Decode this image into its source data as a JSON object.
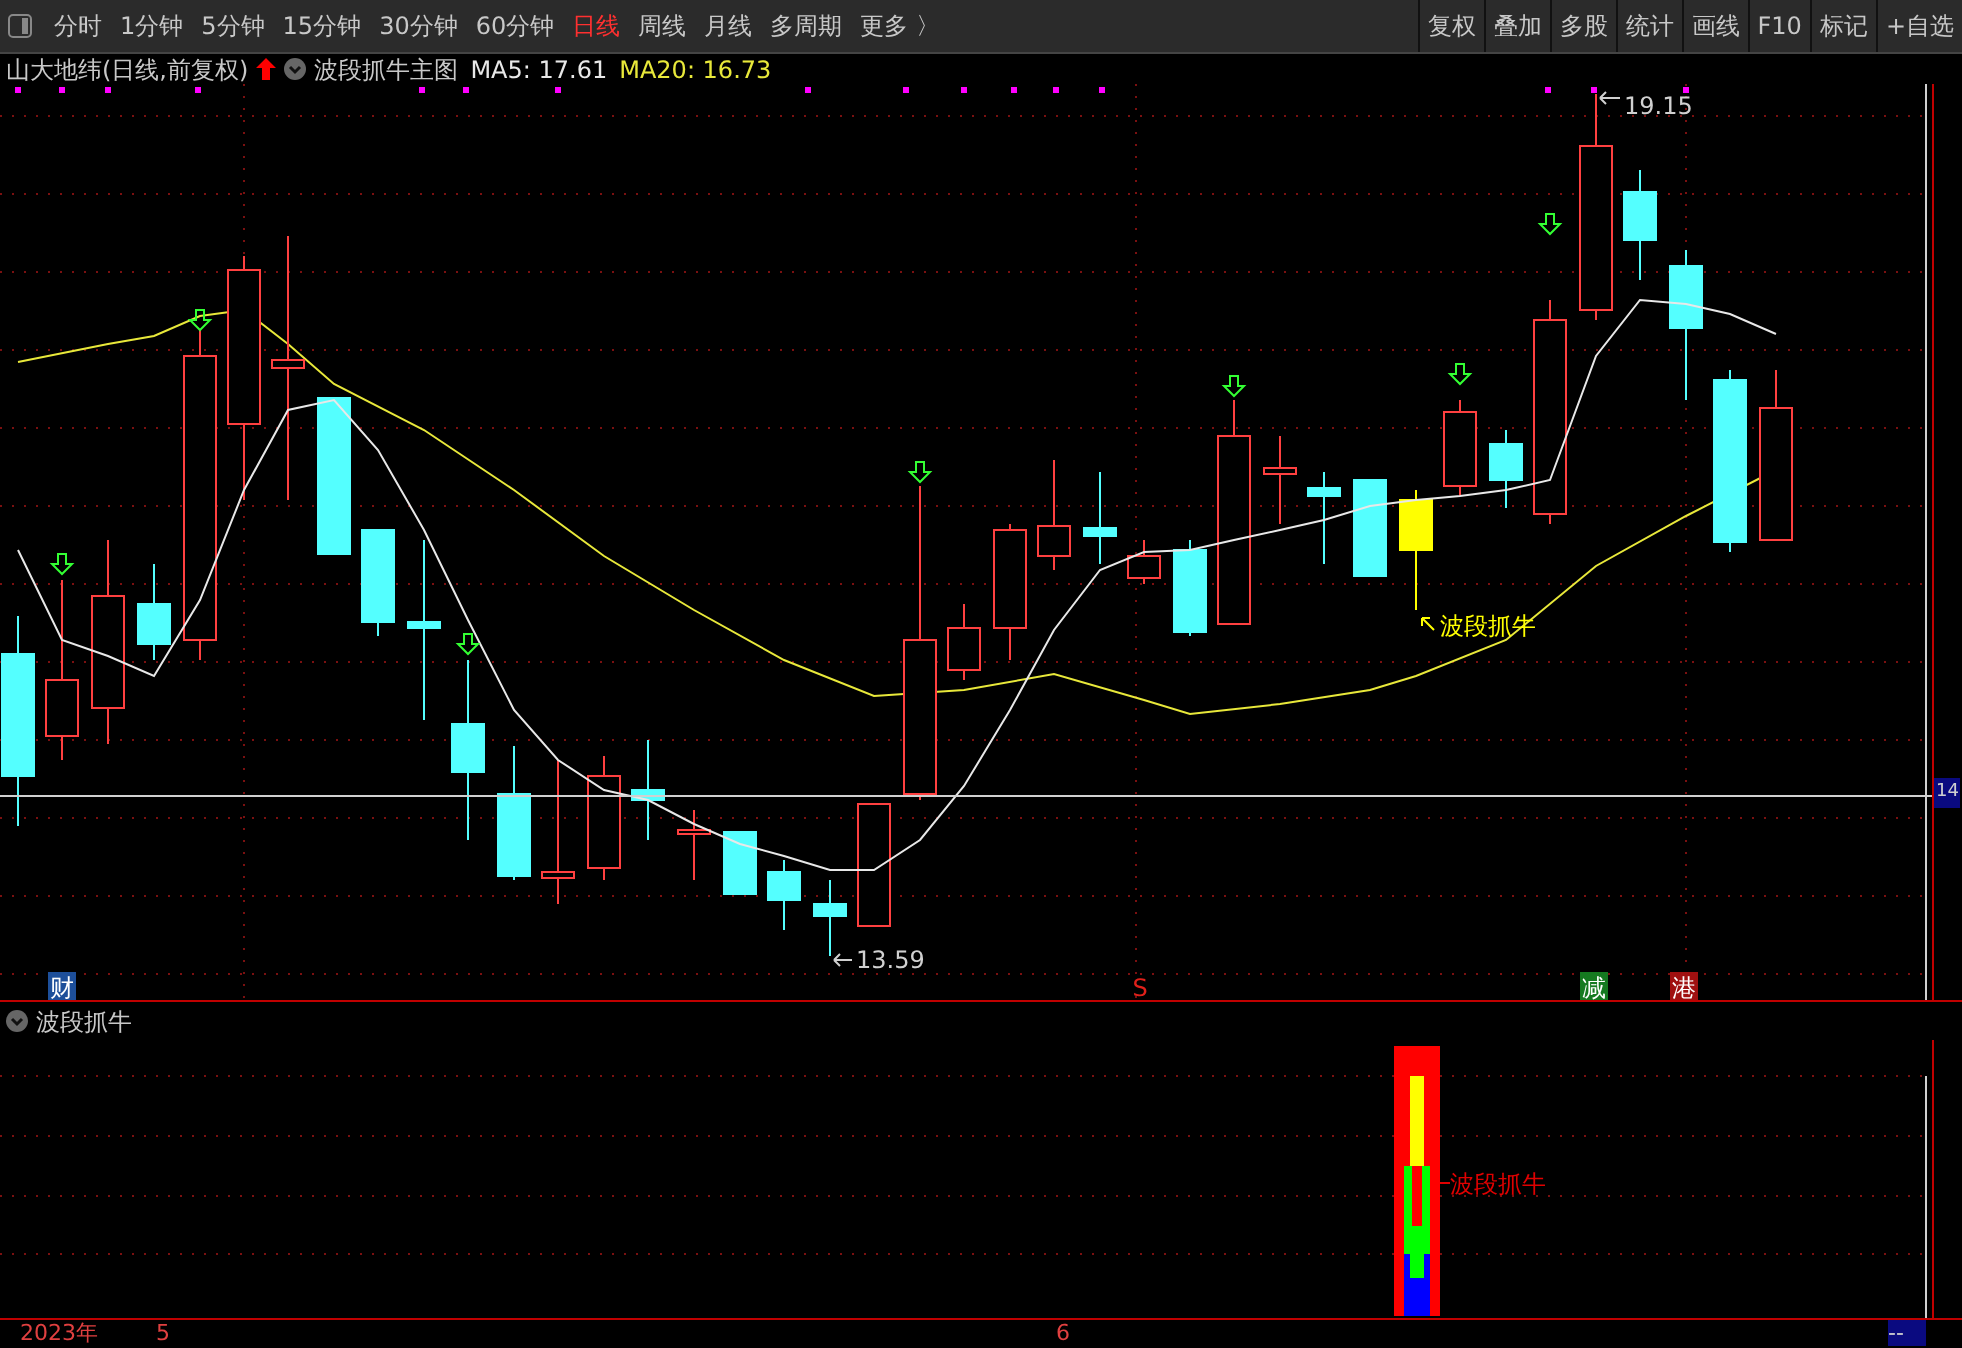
{
  "toolbar": {
    "periods": [
      {
        "label": "分时",
        "selected": false
      },
      {
        "label": "1分钟",
        "selected": false
      },
      {
        "label": "5分钟",
        "selected": false
      },
      {
        "label": "15分钟",
        "selected": false
      },
      {
        "label": "30分钟",
        "selected": false
      },
      {
        "label": "60分钟",
        "selected": false
      },
      {
        "label": "日线",
        "selected": true
      },
      {
        "label": "周线",
        "selected": false
      },
      {
        "label": "月线",
        "selected": false
      },
      {
        "label": "多周期",
        "selected": false
      }
    ],
    "more": "更多 〉",
    "actions": [
      "复权",
      "叠加",
      "多股",
      "统计",
      "画线",
      "F10",
      "标记",
      "+自选"
    ]
  },
  "info": {
    "stock": "山大地纬(日线,前复权)",
    "indicator": "波段抓牛主图",
    "ma5": "MA5: 17.61",
    "ma20": "MA20: 16.73"
  },
  "main_chart": {
    "high_label": "19.15",
    "low_label": "13.59",
    "signal_label": "波段抓牛",
    "crosshair_price": "14",
    "events": [
      {
        "label": "财",
        "kind": "badge",
        "color": "#1d4f9a"
      },
      {
        "label": "S",
        "kind": "text",
        "color": "#e0201a"
      },
      {
        "label": "减",
        "kind": "badge",
        "color": "#157a20"
      },
      {
        "label": "港",
        "kind": "badge",
        "color": "#a01010"
      }
    ]
  },
  "sub_chart": {
    "title": "波段抓牛",
    "signal_label": "波段抓牛"
  },
  "time_axis": {
    "labels": [
      "2023年",
      "5",
      "6"
    ],
    "cursor": "--"
  }
}
